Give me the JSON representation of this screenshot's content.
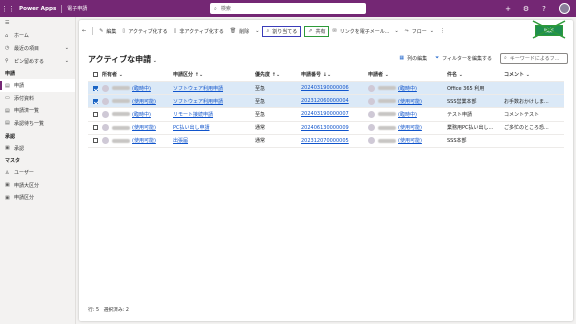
{
  "topbar": {
    "app_name": "Power Apps",
    "app_sub": "電子申請",
    "search_placeholder": "検索"
  },
  "sidebar": {
    "items_top": [
      {
        "label": "ホーム",
        "icon": "home-icon"
      },
      {
        "label": "最近の項目",
        "icon": "clock-icon",
        "chevron": true
      },
      {
        "label": "ピン留めする",
        "icon": "pin-icon",
        "chevron": true
      }
    ],
    "group_app": "申請",
    "items_app": [
      {
        "label": "申請",
        "icon": "form-icon",
        "active": true
      },
      {
        "label": "添付資料",
        "icon": "attachment-icon"
      },
      {
        "label": "申請済一覧",
        "icon": "list-icon"
      },
      {
        "label": "承認待ち一覧",
        "icon": "list-icon"
      }
    ],
    "group_approve": "承認",
    "items_approve": [
      {
        "label": "承認",
        "icon": "approve-icon"
      }
    ],
    "group_master": "マスタ",
    "items_master": [
      {
        "label": "ユーザー",
        "icon": "person-icon"
      },
      {
        "label": "申請大区分",
        "icon": "category-icon"
      },
      {
        "label": "申請区分",
        "icon": "category-icon"
      }
    ]
  },
  "commands": {
    "back": "←",
    "edit": "編集",
    "activate": "アクティブ化する",
    "deactivate": "非アクティブ化する",
    "delete": "削除",
    "assign": "割り当てる",
    "share": "共有",
    "email_link": "リンクを電子メール...",
    "flow": "フロー",
    "edit_filter": "編集"
  },
  "view": {
    "title": "アクティブな申請",
    "edit_columns": "列の編集",
    "edit_filters": "フィルターを編集する",
    "keyword_placeholder": "キーワードによるフ..."
  },
  "grid": {
    "headers": [
      "所有者",
      "申請区分",
      "優先度",
      "申請番号",
      "申請者",
      "件名",
      "コメント"
    ],
    "rows": [
      {
        "selected": true,
        "owner_tag": "(臨時中)",
        "category": "ソフトウェア利用申請",
        "priority": "至急",
        "number": "20240319000000​6",
        "applicant_tag": "(臨時中)",
        "subject": "Office 365 利用",
        "comment": ""
      },
      {
        "selected": true,
        "owner_tag": "(使用可能)",
        "category": "ソフトウェア利用申請",
        "priority": "至急",
        "number": "20231206000000​4",
        "applicant_tag": "(使用可能)",
        "subject": "SSS営業本部",
        "comment": "お手数おかけしま..."
      },
      {
        "selected": false,
        "owner_tag": "(臨時中)",
        "category": "リモート接続申請",
        "priority": "至急",
        "number": "20240319000000​7",
        "applicant_tag": "(臨時中)",
        "subject": "テスト申請",
        "comment": "コメントテスト"
      },
      {
        "selected": false,
        "owner_tag": "(使用可能)",
        "category": "PC払い出し申請",
        "priority": "通常",
        "number": "20240613000000​9",
        "applicant_tag": "(使用可能)",
        "subject": "業務用PC払い出し...",
        "comment": "ご多忙のところ恐..."
      },
      {
        "selected": false,
        "owner_tag": "(使用可能)",
        "category": "出張届",
        "priority": "通常",
        "number": "20231207000000​5",
        "applicant_tag": "(使用可能)",
        "subject": "SSS本部",
        "comment": ""
      }
    ]
  },
  "footer": {
    "rows_label": "行: 5",
    "selected_label": "選択済み: 2"
  }
}
